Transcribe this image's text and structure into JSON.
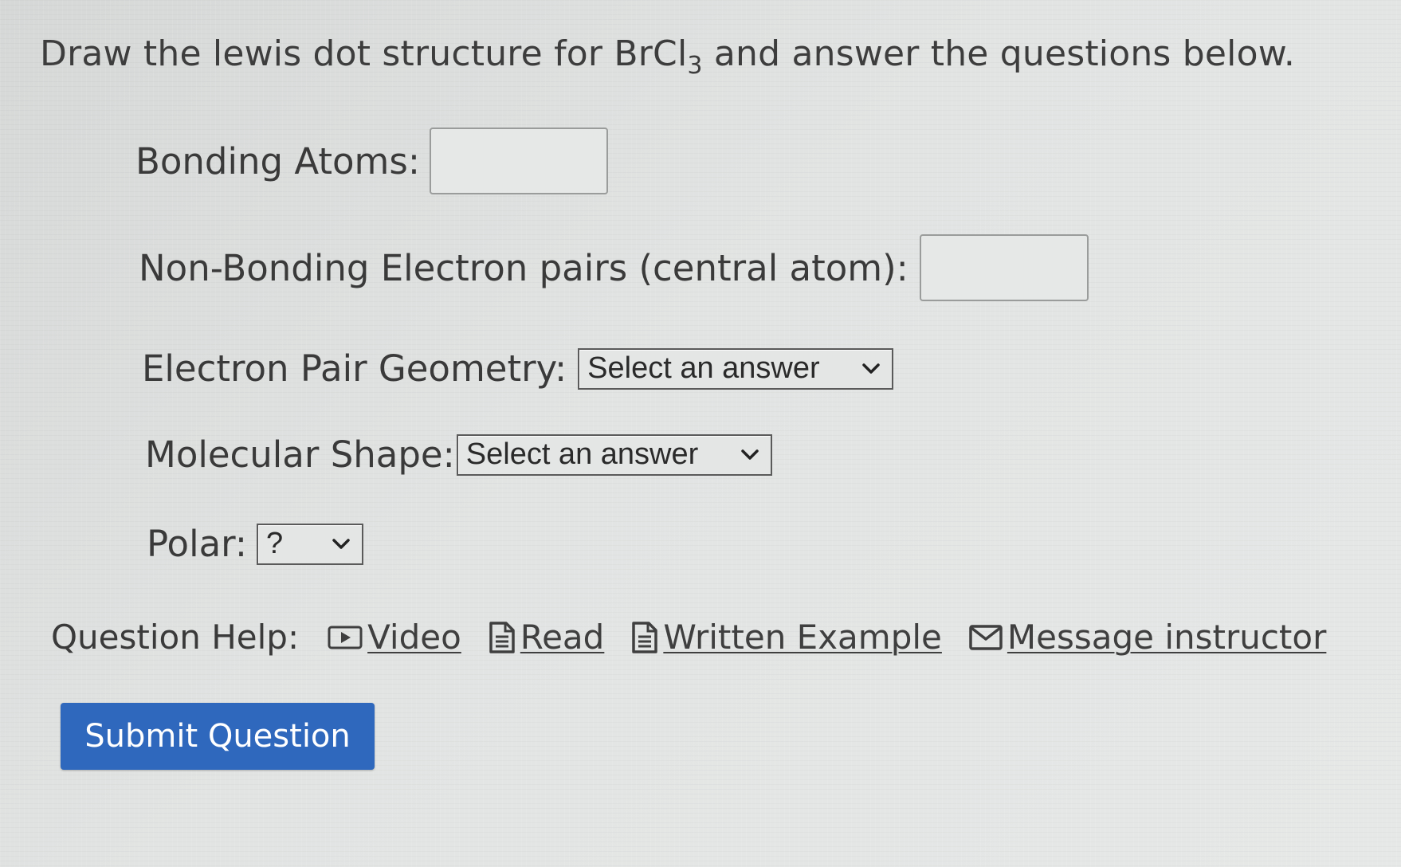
{
  "question": {
    "prefix": "Draw the lewis dot structure for BrCl",
    "subscript": "3",
    "suffix": " and answer the questions below."
  },
  "fields": {
    "bonding_atoms": {
      "label": "Bonding Atoms:",
      "value": ""
    },
    "nonbonding_pairs": {
      "label": "Non-Bonding Electron pairs (central atom):",
      "value": ""
    },
    "electron_pair_geometry": {
      "label": "Electron Pair Geometry:",
      "selected": "Select an answer"
    },
    "molecular_shape": {
      "label": "Molecular Shape:",
      "selected": "Select an answer"
    },
    "polar": {
      "label": "Polar:",
      "selected": "?"
    }
  },
  "help": {
    "label": "Question Help:",
    "links": [
      {
        "label": "Video",
        "icon": "video-icon"
      },
      {
        "label": "Read",
        "icon": "document-icon"
      },
      {
        "label": "Written Example",
        "icon": "document-icon"
      },
      {
        "label": "Message instructor",
        "icon": "envelope-icon"
      }
    ]
  },
  "submit": {
    "label": "Submit Question"
  },
  "colors": {
    "submit_bg": "#2f68bd",
    "background": "#dcdedd"
  }
}
